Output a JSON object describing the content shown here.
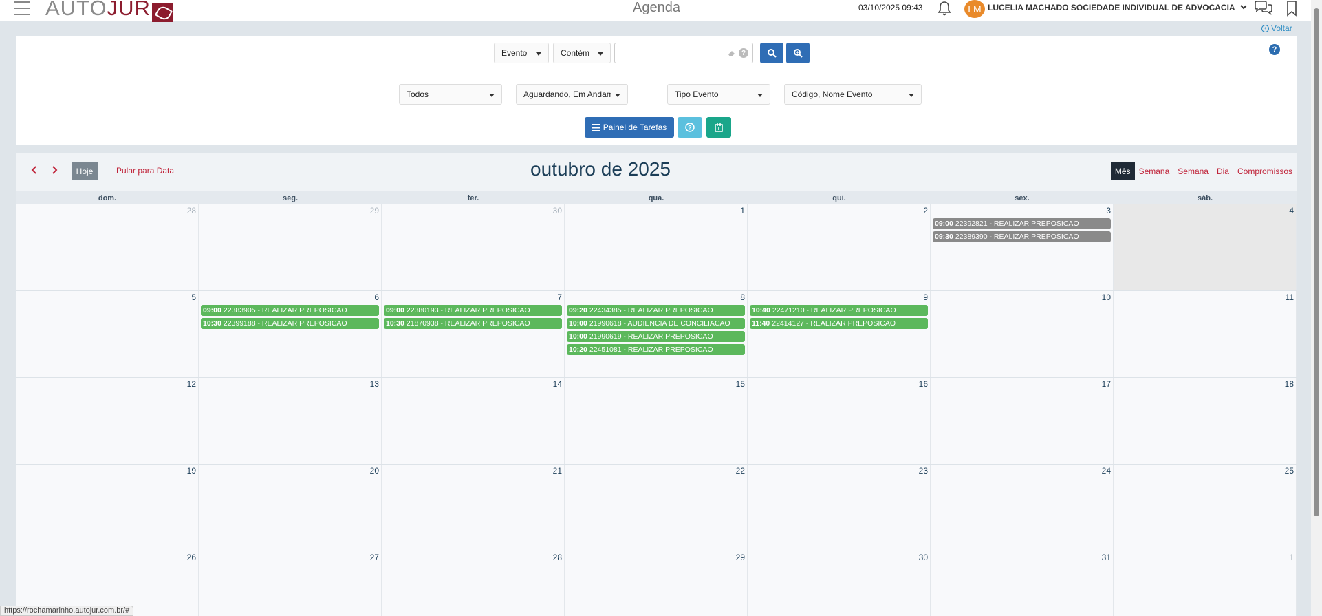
{
  "header": {
    "logo_text_auto": "AUTO",
    "logo_text_jur": "JUR",
    "page_title": "Agenda",
    "datetime": "03/10/2025 09:43",
    "avatar_initials": "LM",
    "user_name": "LUCELIA MACHADO SOCIEDADE INDIVIDUAL DE ADVOCACIA"
  },
  "voltar_label": "Voltar",
  "filters": {
    "field_select": "Evento",
    "operator_select": "Contém",
    "search_value": "",
    "responsible_select": "Todos",
    "status_select": "Aguardando, Em Andamento, I",
    "type_select": "Tipo Evento",
    "display_select": "Código, Nome Evento",
    "task_panel_label": "Painel de Tarefas"
  },
  "calendar": {
    "month_title": "outubro de 2025",
    "today_label": "Hoje",
    "jump_label": "Pular para Data",
    "views": [
      "Mês",
      "Semana",
      "Semana",
      "Dia",
      "Compromissos"
    ],
    "active_view": "Mês",
    "weekdays": [
      "dom.",
      "seg.",
      "ter.",
      "qua.",
      "qui.",
      "sex.",
      "sáb."
    ],
    "weeks": [
      [
        {
          "day": "28",
          "other": true,
          "events": []
        },
        {
          "day": "29",
          "other": true,
          "events": []
        },
        {
          "day": "30",
          "other": true,
          "events": []
        },
        {
          "day": "1",
          "other": false,
          "events": []
        },
        {
          "day": "2",
          "other": false,
          "events": []
        },
        {
          "day": "3",
          "other": false,
          "events": [
            {
              "time": "09:00",
              "text": "22392821 - REALIZAR PREPOSICAO",
              "color": "gray"
            },
            {
              "time": "09:30",
              "text": "22389390 - REALIZAR PREPOSICAO",
              "color": "gray"
            }
          ]
        },
        {
          "day": "4",
          "other": false,
          "shade": true,
          "events": []
        }
      ],
      [
        {
          "day": "5",
          "other": false,
          "events": []
        },
        {
          "day": "6",
          "other": false,
          "events": [
            {
              "time": "09:00",
              "text": "22383905 - REALIZAR PREPOSICAO",
              "color": "green"
            },
            {
              "time": "10:30",
              "text": "22399188 - REALIZAR PREPOSICAO",
              "color": "green"
            }
          ]
        },
        {
          "day": "7",
          "other": false,
          "events": [
            {
              "time": "09:00",
              "text": "22380193 - REALIZAR PREPOSICAO",
              "color": "green"
            },
            {
              "time": "10:30",
              "text": "21870938 - REALIZAR PREPOSICAO",
              "color": "green"
            }
          ]
        },
        {
          "day": "8",
          "other": false,
          "events": [
            {
              "time": "09:20",
              "text": "22434385 - REALIZAR PREPOSICAO",
              "color": "green"
            },
            {
              "time": "10:00",
              "text": "21990618 - AUDIENCIA DE CONCILIACAO",
              "color": "green"
            },
            {
              "time": "10:00",
              "text": "21990619 - REALIZAR PREPOSICAO",
              "color": "green"
            },
            {
              "time": "10:20",
              "text": "22451081 - REALIZAR PREPOSICAO",
              "color": "green"
            }
          ]
        },
        {
          "day": "9",
          "other": false,
          "events": [
            {
              "time": "10:40",
              "text": "22471210 - REALIZAR PREPOSICAO",
              "color": "green"
            },
            {
              "time": "11:40",
              "text": "22414127 - REALIZAR PREPOSICAO",
              "color": "green"
            }
          ]
        },
        {
          "day": "10",
          "other": false,
          "events": []
        },
        {
          "day": "11",
          "other": false,
          "events": []
        }
      ],
      [
        {
          "day": "12",
          "other": false,
          "events": []
        },
        {
          "day": "13",
          "other": false,
          "events": []
        },
        {
          "day": "14",
          "other": false,
          "events": []
        },
        {
          "day": "15",
          "other": false,
          "events": []
        },
        {
          "day": "16",
          "other": false,
          "events": []
        },
        {
          "day": "17",
          "other": false,
          "events": []
        },
        {
          "day": "18",
          "other": false,
          "events": []
        }
      ],
      [
        {
          "day": "19",
          "other": false,
          "events": []
        },
        {
          "day": "20",
          "other": false,
          "events": []
        },
        {
          "day": "21",
          "other": false,
          "events": []
        },
        {
          "day": "22",
          "other": false,
          "events": []
        },
        {
          "day": "23",
          "other": false,
          "events": []
        },
        {
          "day": "24",
          "other": false,
          "events": []
        },
        {
          "day": "25",
          "other": false,
          "events": []
        }
      ],
      [
        {
          "day": "26",
          "other": false,
          "events": []
        },
        {
          "day": "27",
          "other": false,
          "events": []
        },
        {
          "day": "28",
          "other": false,
          "events": []
        },
        {
          "day": "29",
          "other": false,
          "events": []
        },
        {
          "day": "30",
          "other": false,
          "events": []
        },
        {
          "day": "31",
          "other": false,
          "events": []
        },
        {
          "day": "1",
          "other": true,
          "events": []
        }
      ]
    ]
  },
  "status_url": "https://rochamarinho.autojur.com.br/#",
  "colors": {
    "primary_blue": "#2f6db5",
    "event_green": "#5cb85c",
    "event_gray": "#8a8a8a",
    "brand_red": "#8c1c2e",
    "link_red": "#c0243a"
  }
}
